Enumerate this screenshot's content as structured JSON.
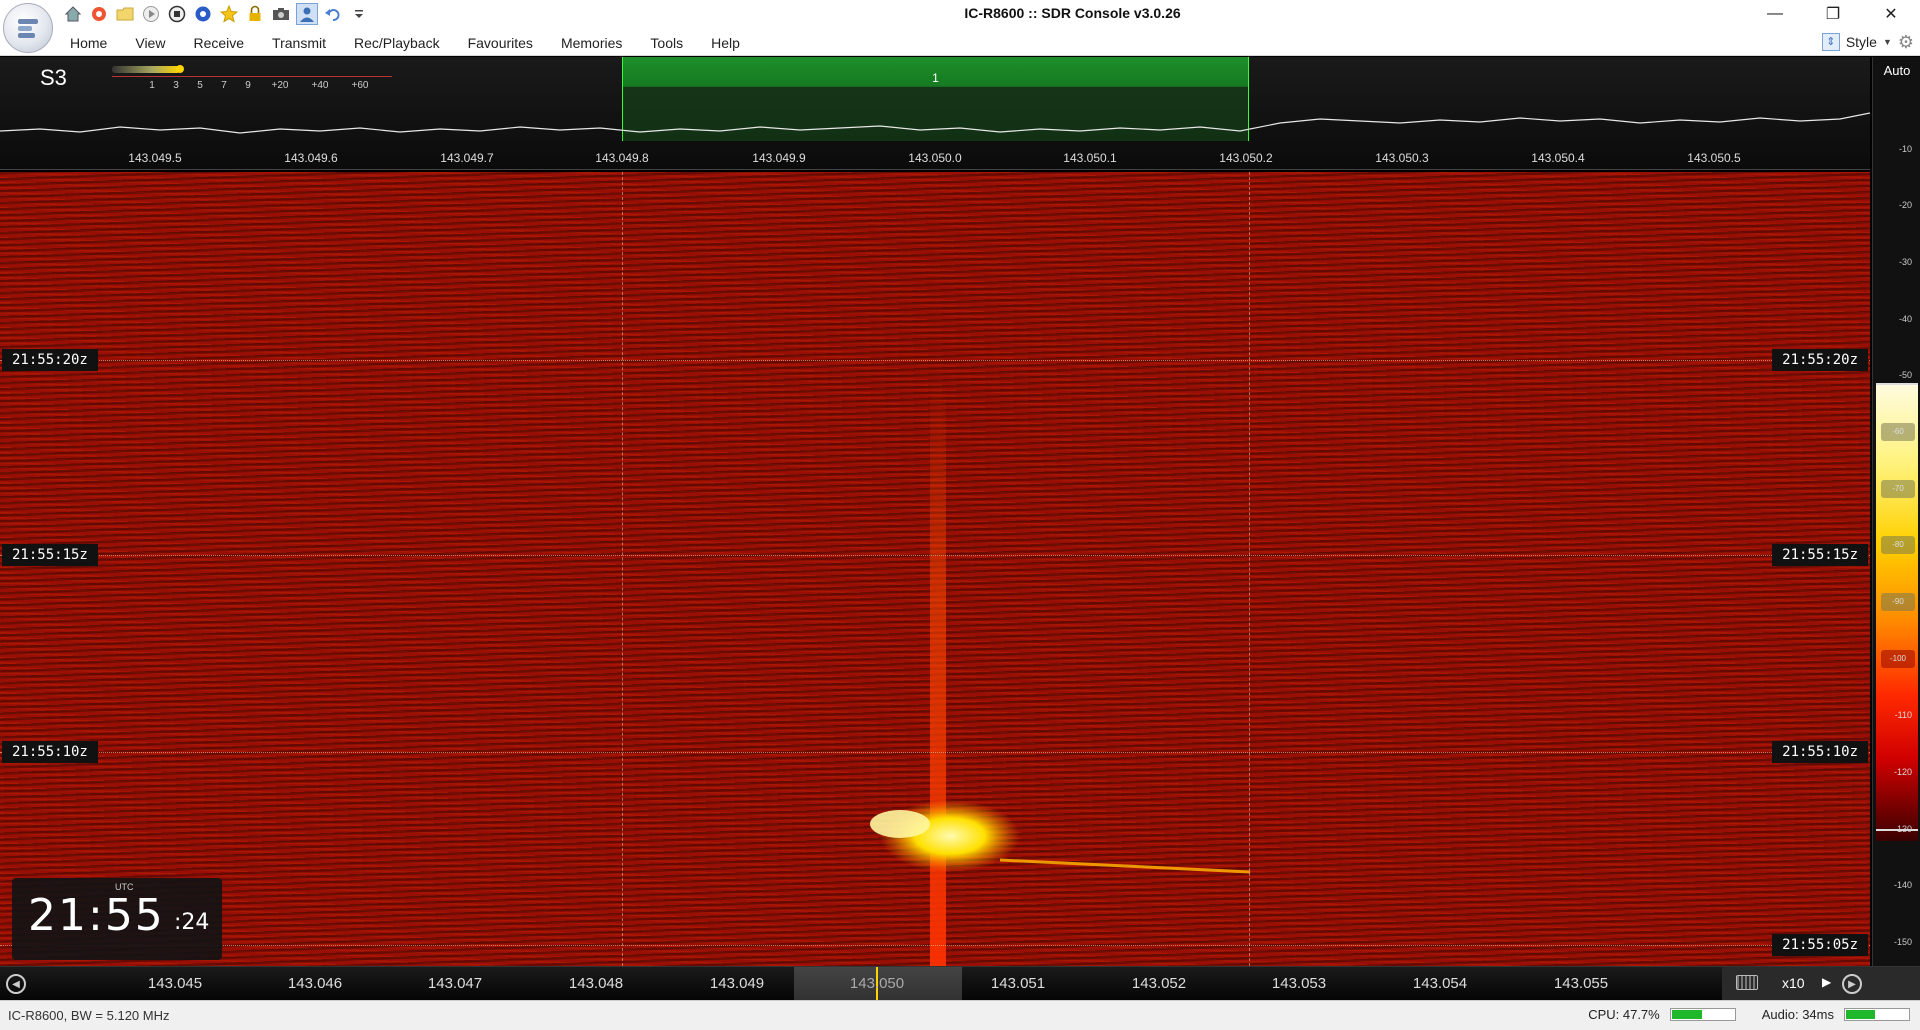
{
  "window": {
    "title": "IC-R8600 :: SDR Console v3.0.26",
    "minimize": "—",
    "restore": "❐",
    "close": "✕"
  },
  "menu": {
    "items": [
      "Home",
      "View",
      "Receive",
      "Transmit",
      "Rec/Playback",
      "Favourites",
      "Memories",
      "Tools",
      "Help"
    ],
    "style_label": "Style"
  },
  "spectrum": {
    "smeter": "S3",
    "scale": [
      "1",
      "3",
      "5",
      "7",
      "9",
      "+20",
      "+40",
      "+60"
    ],
    "filter_label": "1",
    "freq_ticks": [
      "143.049.5",
      "143.049.6",
      "143.049.7",
      "143.049.8",
      "143.049.9",
      "143.050.0",
      "143.050.1",
      "143.050.2",
      "143.050.3",
      "143.050.4",
      "143.050.5"
    ],
    "auto_label": "Auto",
    "db_labels": [
      "-10",
      "-20",
      "-30",
      "-40",
      "-50",
      "-60",
      "-70",
      "-80",
      "-90",
      "-100",
      "-110",
      "-120",
      "-130",
      "-140",
      "-150"
    ],
    "ramp_knobs": [
      "-60",
      "-70",
      "-80",
      "-90",
      "-100"
    ]
  },
  "waterfall": {
    "time_labels": [
      "21:55:20z",
      "21:55:15z",
      "21:55:10z",
      "21:55:05z"
    ],
    "clock_tag": "UTC",
    "clock_main": "21:55",
    "clock_sec": ":24"
  },
  "freq_bar": {
    "ticks": [
      "143.045",
      "143.046",
      "143.047",
      "143.048",
      "143.049",
      "143.050",
      "143.051",
      "143.052",
      "143.053",
      "143.054",
      "143.055"
    ],
    "zoom": "x10"
  },
  "status": {
    "left": "IC-R8600, BW = 5.120 MHz",
    "cpu_label": "CPU: 47.7%",
    "cpu_level": 0.477,
    "audio_label": "Audio: 34ms",
    "audio_level": 0.45
  },
  "colors": {
    "waterfall_bg": "#9a0f05",
    "filter_band": "#1e8f2a",
    "signal": "#ffe600",
    "meter_fill": "#1eb82a"
  }
}
